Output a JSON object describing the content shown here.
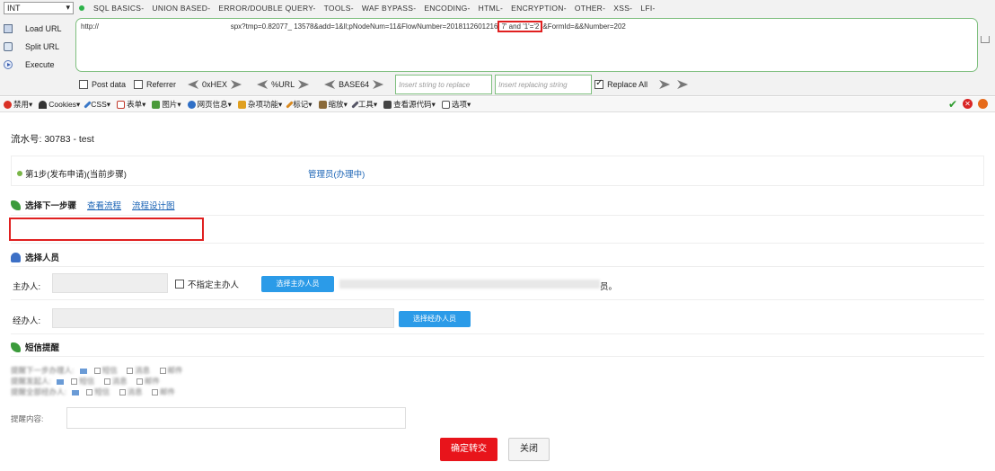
{
  "hackbar": {
    "select_value": "INT",
    "menu": [
      "SQL BASICS-",
      "UNION BASED-",
      "ERROR/DOUBLE QUERY-",
      "TOOLS-",
      "WAF BYPASS-",
      "ENCODING-",
      "HTML-",
      "ENCRYPTION-",
      "OTHER-",
      "XSS-",
      "LFI-"
    ],
    "load_url": "Load URL",
    "split_url": "Split URL",
    "execute": "Execute",
    "url_prefix": "http://",
    "url_mid": "spx?tmp=0.82077_ 13578&add=1&ll;pNodeNum=11&FlowNumber=2018112601216",
    "url_injection": "7' and '1'='2",
    "url_suffix": "&FormId=&&Number=202",
    "post_data": "Post data",
    "referrer": "Referrer",
    "hex": "0xHEX",
    "url": "%URL",
    "base64": "BASE64",
    "replace_placeholder": "Insert string to replace",
    "replacing_placeholder": "Insert replacing string",
    "replace_all": "Replace All"
  },
  "toolbar": {
    "items": [
      {
        "label": "禁用",
        "icon": "disable-icon",
        "color": "#d93025"
      },
      {
        "label": "Cookies",
        "icon": "cookie-icon",
        "color": "#333333"
      },
      {
        "label": "CSS",
        "icon": "pencil-icon",
        "color": "#3a78c8"
      },
      {
        "label": "表单",
        "icon": "form-icon",
        "color": "#c0392b"
      },
      {
        "label": "图片",
        "icon": "image-icon",
        "color": "#4a9a3a"
      },
      {
        "label": "网页信息",
        "icon": "info-icon",
        "color": "#2f6fc6"
      },
      {
        "label": "杂项功能",
        "icon": "misc-icon",
        "color": "#e0a020"
      },
      {
        "label": "标记",
        "icon": "pencil-icon",
        "color": "#d98a20"
      },
      {
        "label": "缩放",
        "icon": "resize-icon",
        "color": "#8a6a3a"
      },
      {
        "label": "工具",
        "icon": "tools-icon",
        "color": "#556"
      },
      {
        "label": "查看源代码",
        "icon": "source-icon",
        "color": "#444"
      },
      {
        "label": "选项",
        "icon": "options-icon",
        "color": "#555"
      }
    ]
  },
  "page": {
    "title": "流水号: 30783 - test",
    "current_step": "第1步(发布申请)(当前步骤)",
    "current_handler": "管理员(办理中)",
    "next_step_label": "选择下一步骤",
    "view_flowchart": "查看流程",
    "design_diagram": "流程设计图",
    "select_people": "选择人员",
    "host_label": "主办人:",
    "no_host_label": "不指定主办人",
    "select_host_btn": "选择主办人员",
    "host_note_tail": "员。",
    "assistant_label": "经办人:",
    "select_assistant_btn": "选择经办人员",
    "remind_title": "短信提醒",
    "remind_row_1": "提醒下一步办理人:",
    "remind_row_2": "提醒发起人:",
    "remind_row_3": "提醒全部经办人:",
    "remind_row_4": "提醒内容:",
    "sms_label": "短信",
    "msg_label": "消息",
    "email_label": "邮件",
    "confirm": "确定转交",
    "close": "关闭"
  }
}
